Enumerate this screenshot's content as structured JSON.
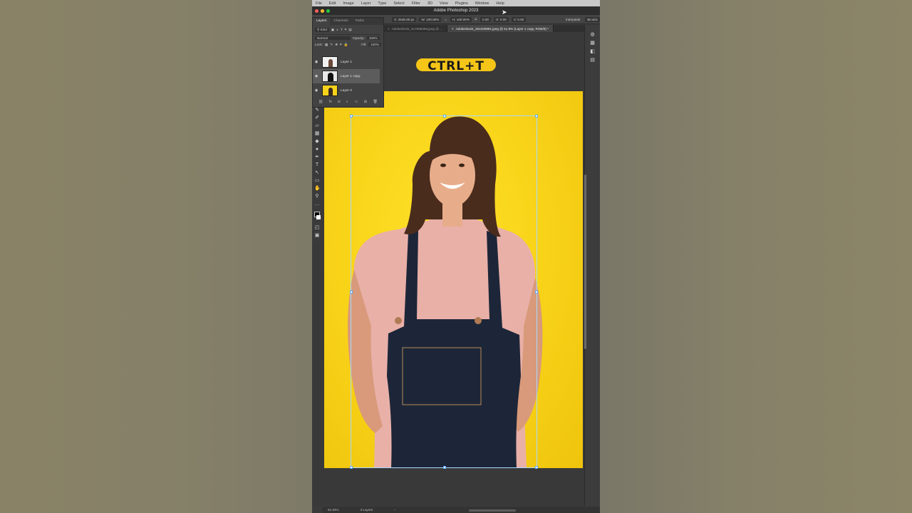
{
  "app": {
    "title": "Adobe Photoshop 2023"
  },
  "menu": [
    "File",
    "Edit",
    "Image",
    "Layer",
    "Type",
    "Select",
    "Filter",
    "3D",
    "View",
    "Plugins",
    "Window",
    "Help"
  ],
  "options_bar": {
    "x": "X: 2646.00 px",
    "w": "W: 100.00%",
    "h": "H: 100.00%",
    "angle": "0.00",
    "hskew": "H: 0.00",
    "vskew": "V: 0.00",
    "interpolation_label": "Interpolati",
    "interpolation_value": "Bicubic"
  },
  "tabs": [
    {
      "label": "AdobeStock_317585358.jpeg @ ...",
      "active": false
    },
    {
      "label": "AdobeStock_251030891.jpeg @ 51.8% (Layer 1 copy, RGB/8) *",
      "active": true
    }
  ],
  "overlay": {
    "badge_text": "CTRL+T",
    "badge_color": "#f5c518"
  },
  "layers_panel": {
    "tabs": [
      "Layers",
      "Channels",
      "Paths"
    ],
    "kind": "Kind",
    "blend_mode": "Normal",
    "opacity_label": "Opacity:",
    "opacity_value": "100%",
    "lock_label": "Lock:",
    "fill_label": "Fill:",
    "fill_value": "100%",
    "layers": [
      {
        "name": "Layer 1",
        "selected": false
      },
      {
        "name": "Layer 1 copy",
        "selected": true
      },
      {
        "name": "Layer 0",
        "selected": false
      }
    ]
  },
  "status": {
    "zoom": "51.84%",
    "info": "3 Layers"
  },
  "colors": {
    "document_bg": "#f9d51a",
    "selection_box": "#a9d8ff"
  }
}
